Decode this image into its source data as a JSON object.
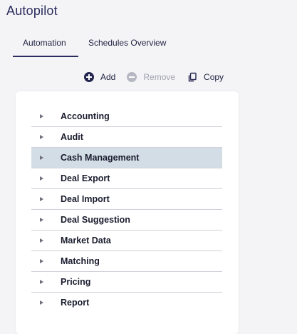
{
  "app": {
    "title": "Autopilot"
  },
  "tabs": [
    {
      "label": "Automation",
      "active": true
    },
    {
      "label": "Schedules Overview",
      "active": false
    }
  ],
  "toolbar": {
    "add_label": "Add",
    "remove_label": "Remove",
    "copy_label": "Copy",
    "remove_disabled": true
  },
  "tree": {
    "selected": "Cash Management",
    "items": [
      {
        "label": "Accounting"
      },
      {
        "label": "Audit"
      },
      {
        "label": "Cash Management"
      },
      {
        "label": "Deal Export"
      },
      {
        "label": "Deal Import"
      },
      {
        "label": "Deal Suggestion"
      },
      {
        "label": "Market Data"
      },
      {
        "label": "Matching"
      },
      {
        "label": "Pricing"
      },
      {
        "label": "Report"
      }
    ]
  },
  "colors": {
    "title": "#2b2d5e",
    "selected_row": "#d3dde6",
    "disabled": "#a0a2b0"
  }
}
